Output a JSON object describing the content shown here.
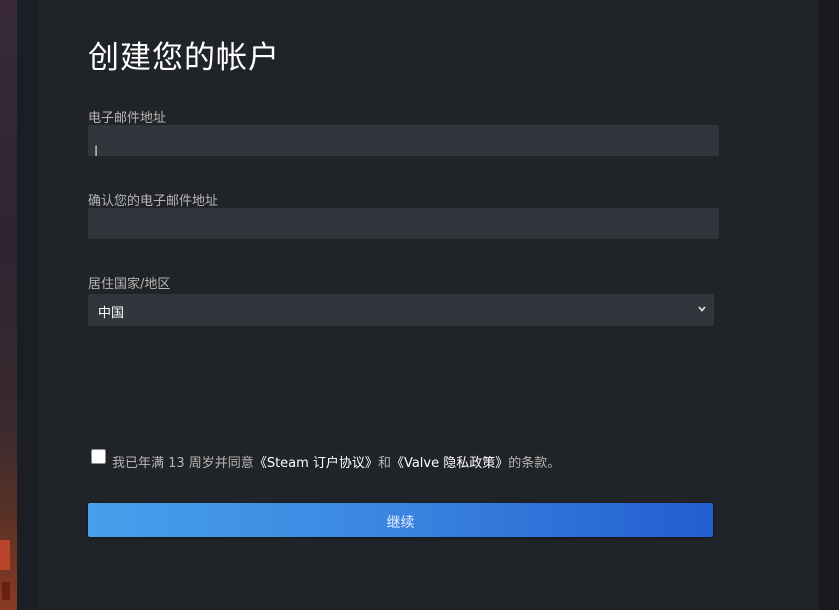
{
  "page": {
    "title": "创建您的帐户"
  },
  "form": {
    "email_label": "电子邮件地址",
    "email_value": "",
    "confirm_email_label": "确认您的电子邮件地址",
    "confirm_email_value": "",
    "country_label": "居住国家/地区",
    "country_selected": "中国"
  },
  "agreement": {
    "checked": false,
    "prefix": "我已年满 13 周岁并同意",
    "steam_link": "《Steam 订户协议》",
    "middle": "和",
    "valve_link": "《Valve 隐私政策》",
    "suffix": "的条款。"
  },
  "actions": {
    "continue_label": "继续"
  },
  "colors": {
    "panel_bg": "#202327",
    "field_bg": "#32353c",
    "label_text": "#b8b6b4",
    "button_start": "#47a0ec",
    "button_end": "#235ecf"
  }
}
